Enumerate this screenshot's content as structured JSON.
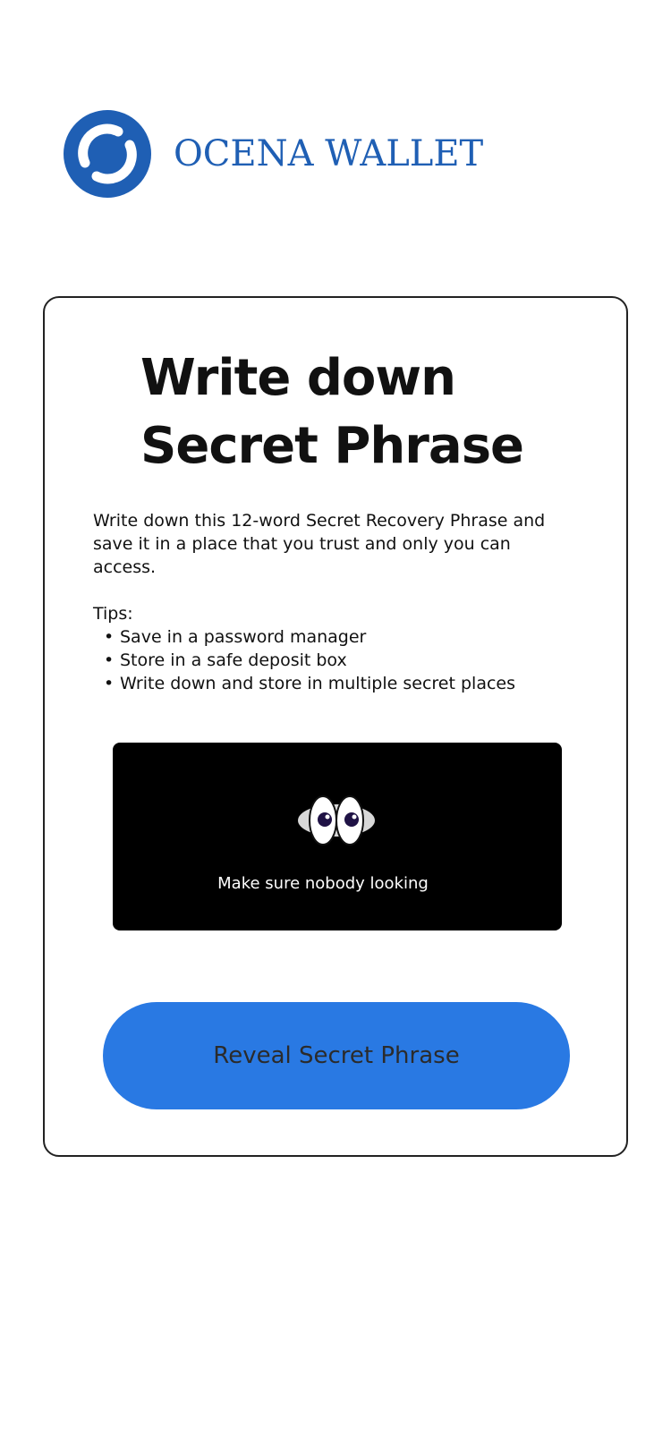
{
  "brand": {
    "name": "OCENA WALLET",
    "logo_icon": "ocena-ring-logo",
    "color": "#1f5fb4"
  },
  "card": {
    "title_line1": "Write down",
    "title_line2": "Secret Phrase",
    "description": "Write down this 12-word Secret Recovery Phrase and save it in a place that you trust and only you can access.",
    "tips_heading": "Tips:",
    "tips": [
      "Save in a password manager",
      "Store in a safe deposit box",
      "Write down and store in multiple secret places"
    ],
    "privacy_panel": {
      "icon": "eyes-icon",
      "text": "Make sure nobody looking"
    },
    "reveal_button_label": "Reveal Secret Phrase"
  },
  "colors": {
    "accent": "#2979e3",
    "panel": "#000000",
    "text": "#111111"
  }
}
